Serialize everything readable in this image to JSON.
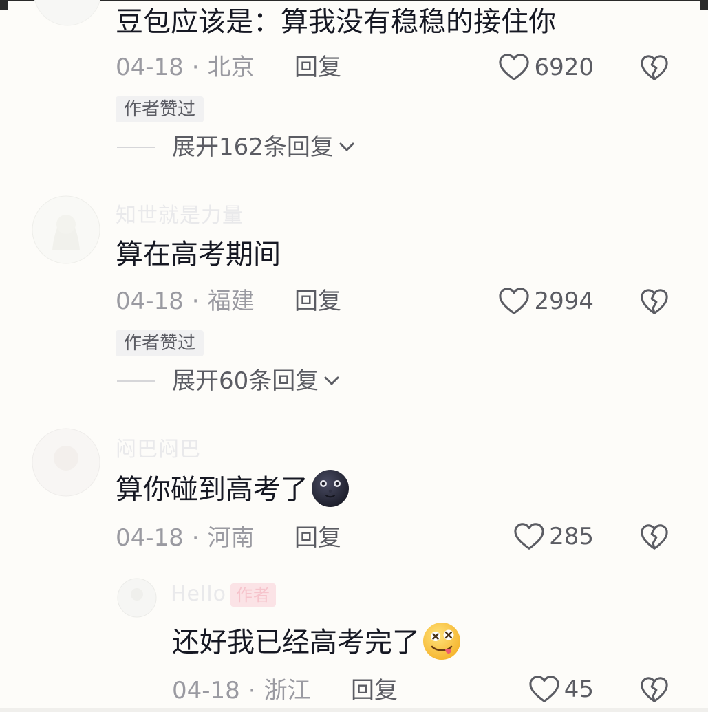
{
  "comments": [
    {
      "username": "",
      "text": "豆包应该是：算我没有稳稳的接住你",
      "date": "04-18",
      "location": "北京",
      "reply_label": "回复",
      "likes": "6920",
      "liked_by_author": "作者赞过",
      "expand_label": "展开162条回复",
      "icons": [
        "heart-outline-icon",
        "broken-heart-icon",
        "chevron-down-icon"
      ]
    },
    {
      "username": "知世就是力量",
      "text": "算在高考期间",
      "date": "04-18",
      "location": "福建",
      "reply_label": "回复",
      "likes": "2994",
      "liked_by_author": "作者赞过",
      "expand_label": "展开60条回复",
      "icons": [
        "heart-outline-icon",
        "broken-heart-icon",
        "chevron-down-icon"
      ]
    },
    {
      "username": "闷巴闷巴",
      "text": "算你碰到高考了",
      "emoji": "new-moon-face-emoji",
      "date": "04-18",
      "location": "河南",
      "reply_label": "回复",
      "likes": "285",
      "icons": [
        "heart-outline-icon",
        "broken-heart-icon"
      ]
    },
    {
      "username": "Hello",
      "author_tag": "作者",
      "text": "还好我已经高考完了",
      "emoji": "dizzy-face-emoji",
      "date": "04-18",
      "location": "浙江",
      "reply_label": "回复",
      "likes": "45",
      "icons": [
        "heart-outline-icon",
        "broken-heart-icon"
      ]
    }
  ],
  "separator": "·",
  "colors": {
    "background": "#fdfcf9",
    "text_primary": "#161823",
    "text_meta": "#9a9aa1",
    "text_secondary": "#5b5c63",
    "badge_bg": "#f1f1f2",
    "author_tag_bg": "#fbe3e6"
  }
}
